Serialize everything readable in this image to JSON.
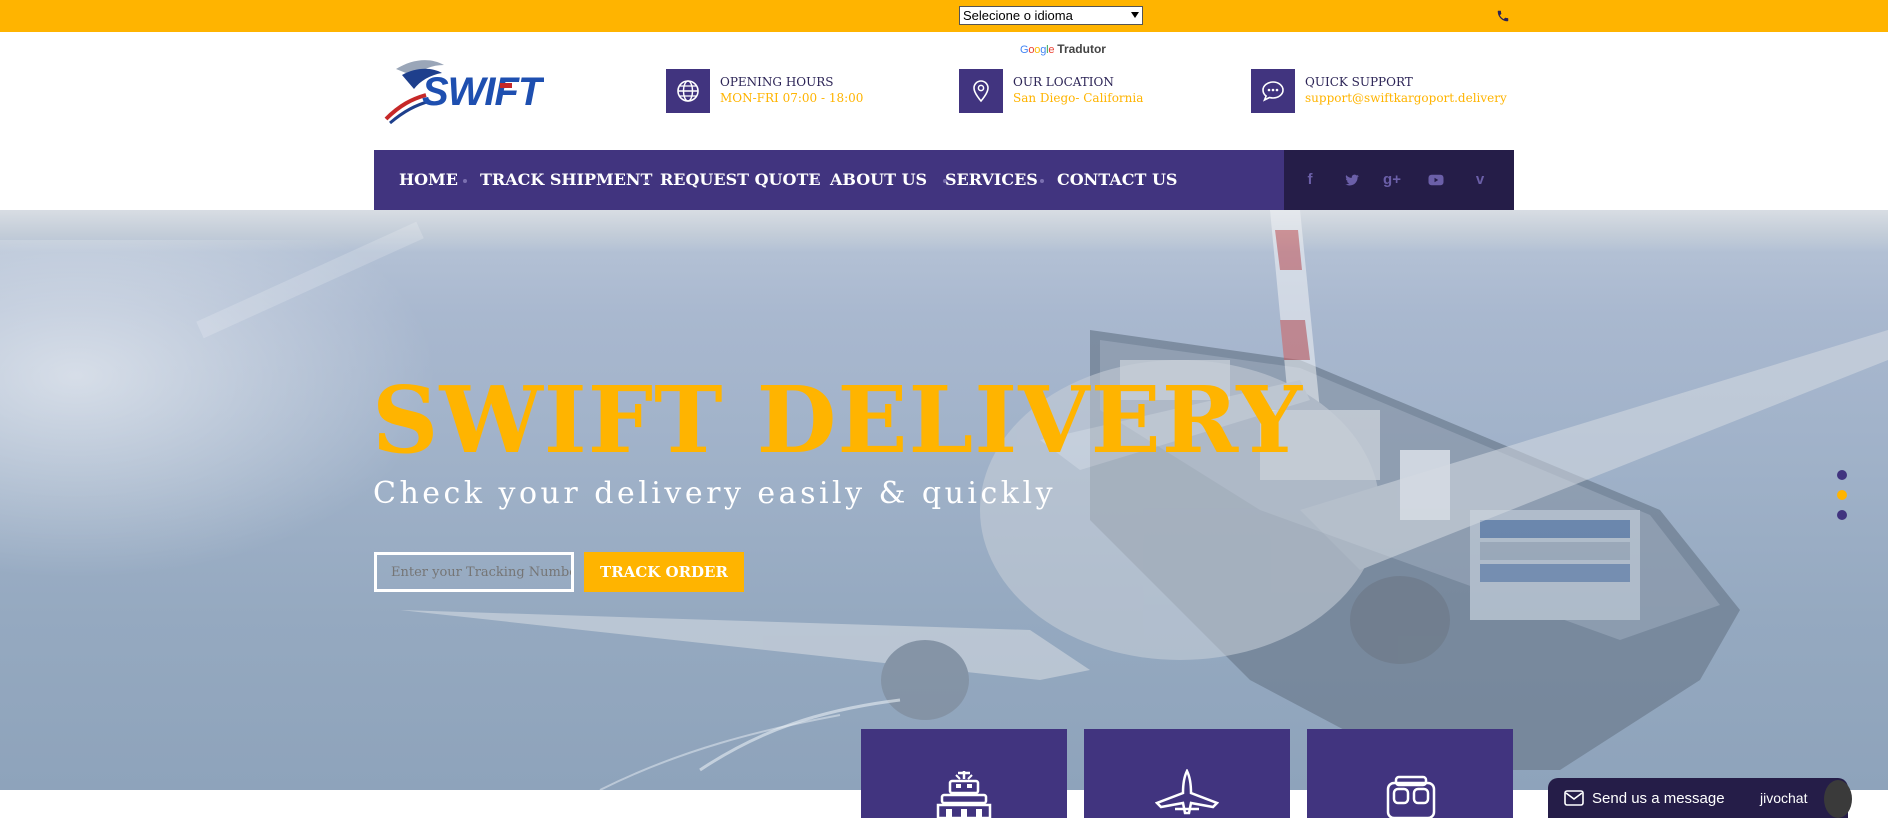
{
  "topbar": {
    "language_select": "Selecione o idioma",
    "translator_brand": "Google",
    "translator_label": "Tradutor",
    "phone_icon": "phone-icon"
  },
  "logo_text": "SWIFT",
  "info": {
    "hours": {
      "title": "OPENING HOURS",
      "value": "MON-FRI 07:00 - 18:00",
      "icon": "globe-icon"
    },
    "location": {
      "title": "OUR LOCATION",
      "value": "San Diego- California",
      "icon": "map-pin-icon"
    },
    "support": {
      "title": "QUICK SUPPORT",
      "value": "support@swiftkargoport.delivery",
      "icon": "chat-bubble-icon"
    }
  },
  "nav": {
    "items": [
      "HOME",
      "TRACK SHIPMENT",
      "REQUEST QUOTE",
      "ABOUT US",
      "SERVICES",
      "CONTACT US"
    ]
  },
  "social": {
    "facebook": "f",
    "twitter": "twitter-icon",
    "google_plus": "g+",
    "youtube": "youtube-icon",
    "vimeo": "v"
  },
  "hero": {
    "title": "SWIFT DELIVERY",
    "subtitle": "Check your delivery easily & quickly",
    "tracking_placeholder": "Enter your Tracking Number",
    "track_button": "TRACK ORDER",
    "slider_dots": 3,
    "active_dot": 2
  },
  "colors": {
    "accent": "#ffb400",
    "primary": "#41347f",
    "dark": "#251d48"
  },
  "services": [
    "ship-icon",
    "airplane-icon",
    "truck-icon"
  ],
  "chat": {
    "message": "Send us a message",
    "brand": "jivochat"
  }
}
